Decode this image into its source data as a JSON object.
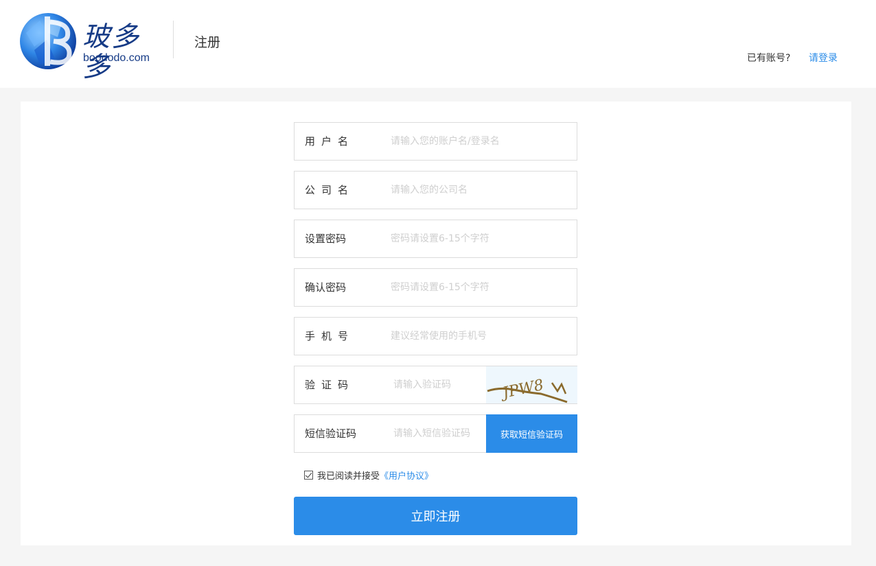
{
  "header": {
    "logo_text": "玻多多",
    "logo_url_text": "boododo.com",
    "title": "注册",
    "have_account": "已有账号?",
    "login_link": "请登录"
  },
  "form": {
    "fields": [
      {
        "label": "用户名",
        "placeholder": "请输入您的账户名/登录名",
        "value": ""
      },
      {
        "label": "公司名",
        "placeholder": "请输入您的公司名",
        "value": ""
      },
      {
        "label": "设置密码",
        "placeholder": "密码请设置6-15个字符",
        "value": ""
      },
      {
        "label": "确认密码",
        "placeholder": "密码请设置6-15个字符",
        "value": ""
      },
      {
        "label": "手机号",
        "placeholder": "建议经常使用的手机号",
        "value": ""
      },
      {
        "label": "验证码",
        "placeholder": "请输入验证码",
        "value": ""
      },
      {
        "label": "短信验证码",
        "placeholder": "请输入短信验证码",
        "value": ""
      }
    ],
    "captcha_text": "JPW8",
    "sms_button": "获取短信验证码",
    "agree_text": "我已阅读并接受",
    "agree_link": "《用户协议》",
    "agree_checked": true,
    "submit": "立即注册"
  },
  "colors": {
    "accent": "#2b8ce8",
    "brand": "#163b86",
    "page_bg": "#f5f5f5"
  }
}
